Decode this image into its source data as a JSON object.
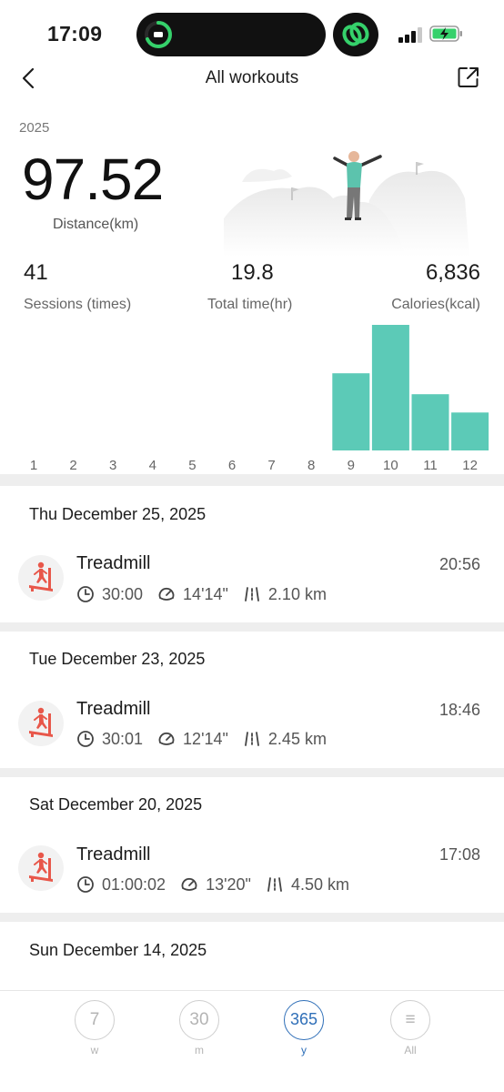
{
  "status_bar": {
    "time": "17:09"
  },
  "nav": {
    "title": "All workouts"
  },
  "summary": {
    "year": "2025",
    "distance_value": "97.52",
    "distance_label": "Distance(km)",
    "stats": [
      {
        "value": "41",
        "label": "Sessions (times)"
      },
      {
        "value": "19.8",
        "label": "Total time(hr)"
      },
      {
        "value": "6,836",
        "label": "Calories(kcal)"
      }
    ]
  },
  "chart_data": {
    "type": "bar",
    "categories": [
      "1",
      "2",
      "3",
      "4",
      "5",
      "6",
      "7",
      "8",
      "9",
      "10",
      "11",
      "12"
    ],
    "values": [
      0,
      0,
      0,
      0,
      0,
      0,
      0,
      0,
      29.5,
      48,
      21.5,
      14.5
    ],
    "bar_color": "#5ccab7"
  },
  "workouts": [
    {
      "date": "Thu December 25, 2025",
      "name": "Treadmill",
      "time": "20:56",
      "duration": "30:00",
      "pace": "14'14\"",
      "distance": "2.10 km"
    },
    {
      "date": "Tue December 23, 2025",
      "name": "Treadmill",
      "time": "18:46",
      "duration": "30:01",
      "pace": "12'14\"",
      "distance": "2.45 km"
    },
    {
      "date": "Sat December 20, 2025",
      "name": "Treadmill",
      "time": "17:08",
      "duration": "01:00:02",
      "pace": "13'20\"",
      "distance": "4.50 km"
    }
  ],
  "last_date": "Sun December 14, 2025",
  "tabs": [
    {
      "value": "7",
      "label": "w"
    },
    {
      "value": "30",
      "label": "m"
    },
    {
      "value": "365",
      "label": "y",
      "active": true
    },
    {
      "value": "≡",
      "label": "All"
    }
  ],
  "colors": {
    "accent": "#2f6fb8",
    "bar": "#5ccab7",
    "icon_red": "#e8574a",
    "green": "#35d16b"
  },
  "icons": [
    "back-icon",
    "share-icon",
    "treadmill-icon",
    "clock-icon",
    "pace-icon",
    "distance-icon",
    "menu-icon"
  ]
}
